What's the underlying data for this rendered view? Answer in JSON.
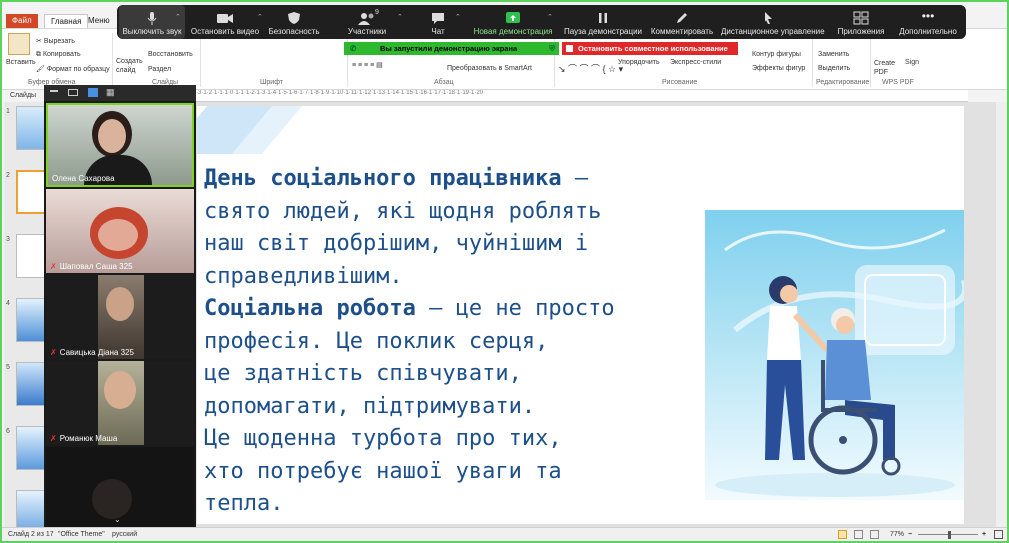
{
  "ribbon": {
    "tab_file": "Файл",
    "tab_home": "Главная",
    "tab_menu": "Меню",
    "paste": "Вставить",
    "cut": "Вырезать",
    "copy": "Копировать",
    "format_painter": "Формат по образцу",
    "new_slide": "Создать слайд",
    "restore": "Восстановить",
    "section": "Раздел",
    "group_clipboard": "Буфер обмена",
    "group_slides": "Слайды",
    "group_font": "Шрифт",
    "group_paragraph": "Абзац",
    "group_drawing": "Рисование",
    "group_editing": "Редактирование",
    "group_wps": "WPS PDF",
    "convert_smartart": "Преобразовать в SmartArt",
    "arrange": "Упорядочить",
    "quick_styles": "Экспресс-стили",
    "shape_outline": "Контур фигуры",
    "shape_effects": "Эффекты фигур",
    "replace": "Заменить",
    "select": "Выделить",
    "create_pdf": "Create PDF",
    "sign": "Sign"
  },
  "zoom": {
    "mute": "Выключить звук",
    "stop_video": "Остановить видео",
    "security": "Безопасность",
    "participants": "Участники",
    "participants_count": "9",
    "chat": "Чат",
    "new_share": "Новая демонстрация",
    "pause_share": "Пауза демонстрации",
    "annotate": "Комментировать",
    "remote_control": "Дистанционное управление",
    "apps": "Приложения",
    "more": "Дополнительно",
    "share_banner": "Вы запустили демонстрацию экрана",
    "stop_share": "Остановить совместное использование"
  },
  "slides_panel": {
    "header": "Слайды",
    "numbers": [
      "1",
      "2",
      "3",
      "4",
      "5",
      "6"
    ]
  },
  "participants": [
    {
      "name": "Олена Сахарова",
      "muted": false
    },
    {
      "name": "Шаповал Саша 325",
      "muted": true
    },
    {
      "name": "Савицька Діана 325",
      "muted": true
    },
    {
      "name": "Романюк Маша",
      "muted": true
    },
    {
      "name": "",
      "muted": false
    }
  ],
  "slide": {
    "title_bold": "День соціального працівника",
    "title_rest": " —",
    "line2": "свято людей, які щодня роблять",
    "line3": "наш світ добрішим, чуйнішим і",
    "line4": "справедливішим.",
    "social_bold": "Соціальна робота",
    "social_rest": " — це не просто",
    "line6": "професія. Це поклик серця,",
    "line7": "це здатність співчувати,",
    "line8": "допомагати, підтримувати.",
    "line9": "Це щоденна турбота про тих,",
    "line10": "хто потребує нашої уваги та",
    "line11": "тепла."
  },
  "ruler": "·3·1·2·1·1·1·0·1·1·1·2·1·3·1·4·1·5·1·6·1·7·1·8·1·9·1·10·1·11·1·12·1·13·1·14·1·15·1·16·1·17·1·18·1·19·1·20·",
  "status": {
    "slide_of": "Слайд 2 из 17",
    "theme": "\"Office Theme\"",
    "language": "русский",
    "zoom": "77%"
  }
}
